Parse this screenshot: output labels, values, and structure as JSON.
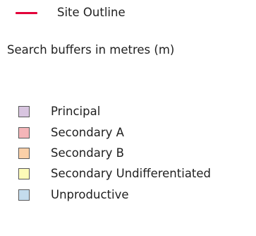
{
  "legend": {
    "site_outline": {
      "label": "Site Outline",
      "color": "#e3003a"
    },
    "buffers_title": "Search buffers in metres (m)",
    "items": [
      {
        "label": "Principal",
        "color": "#d8c5e0"
      },
      {
        "label": "Secondary A",
        "color": "#f4b5b8"
      },
      {
        "label": "Secondary B",
        "color": "#fbd0a8"
      },
      {
        "label": "Secondary Undifferentiated",
        "color": "#fdfbb8"
      },
      {
        "label": "Unproductive",
        "color": "#c4dced"
      }
    ]
  }
}
